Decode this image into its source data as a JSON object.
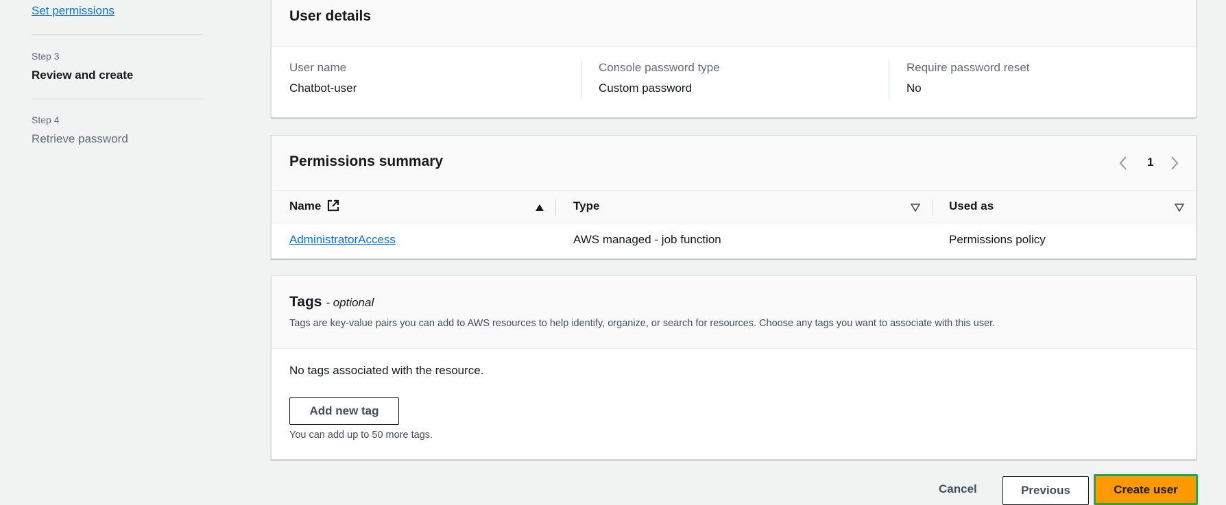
{
  "steps": {
    "set_permissions": "Set permissions",
    "step3_label": "Step 3",
    "step3_title": "Review and create",
    "step4_label": "Step 4",
    "step4_title": "Retrieve password"
  },
  "user_details": {
    "title": "User details",
    "fields": [
      {
        "label": "User name",
        "value": "Chatbot-user"
      },
      {
        "label": "Console password type",
        "value": "Custom password"
      },
      {
        "label": "Require password reset",
        "value": "No"
      }
    ]
  },
  "permissions": {
    "title": "Permissions summary",
    "page": "1",
    "columns": [
      "Name",
      "Type",
      "Used as"
    ],
    "rows": [
      {
        "name": "AdministratorAccess",
        "type": "AWS managed - job function",
        "used_as": "Permissions policy"
      }
    ]
  },
  "tags": {
    "title": "Tags",
    "optional": "- optional",
    "description": "Tags are key-value pairs you can add to AWS resources to help identify, organize, or search for resources. Choose any tags you want to associate with this user.",
    "empty_text": "No tags associated with the resource.",
    "add_button": "Add new tag",
    "limit_text": "You can add up to 50 more tags."
  },
  "footer": {
    "cancel": "Cancel",
    "previous": "Previous",
    "create": "Create user"
  },
  "colors": {
    "link": "#0972d3",
    "primary": "#ff9900",
    "highlight": "#1fa84a"
  }
}
